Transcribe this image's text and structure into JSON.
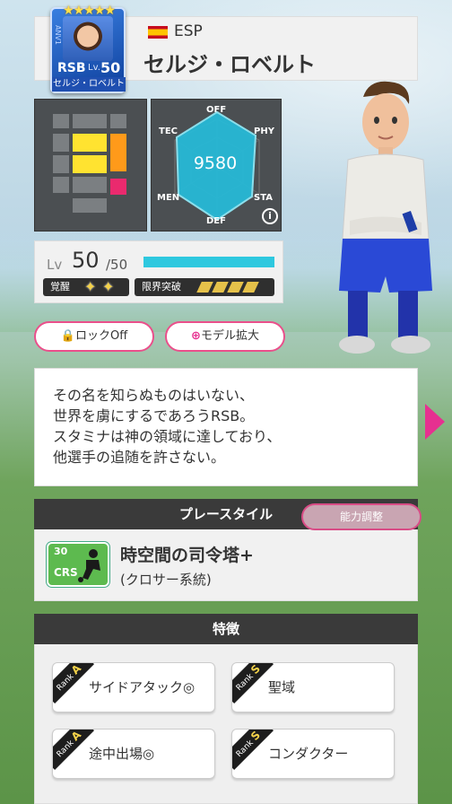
{
  "card": {
    "stars": "★★★★★",
    "position": "RSB",
    "lv_prefix": "Lv.",
    "level": "50",
    "short_name": "セルジ・ロベルト",
    "side_text": "ANV1"
  },
  "header": {
    "country": "ESP",
    "player_name": "セルジ・ロベルト"
  },
  "radar": {
    "value": "9580",
    "labels": {
      "top": "OFF",
      "top_left": "TEC",
      "top_right": "PHY",
      "bottom_left": "MEN",
      "bottom_right": "STA",
      "bottom": "DEF"
    }
  },
  "level": {
    "label": "Lv",
    "current": "50",
    "max": "/50",
    "progress": 1.0,
    "awakening_label": "覚醒",
    "limit_label": "限界突破"
  },
  "buttons": {
    "lock": "ロックOff",
    "model": "モデル拡大"
  },
  "description": [
    "その名を知らぬものはいない、",
    "世界を虜にするであろうRSB。",
    "スタミナは神の領域に達しており、",
    "他選手の追随を許さない。"
  ],
  "play_style": {
    "header": "プレースタイル",
    "ability_button": "能力調整",
    "icon_value": "30",
    "icon_label": "CRS",
    "title": "時空間の司令塔+",
    "subtitle": "(クロサー系統)"
  },
  "traits": {
    "header": "特徴",
    "rank_prefix": "Rank",
    "items": [
      {
        "rank": "A",
        "label": "サイドアタック◎"
      },
      {
        "rank": "S",
        "label": "聖域"
      },
      {
        "rank": "A",
        "label": "途中出場◎"
      },
      {
        "rank": "S",
        "label": "コンダクター"
      }
    ]
  },
  "colors": {
    "accent_pink": "#ea4f8b",
    "cyan": "#2ec8df",
    "yellow": "#ffe330"
  }
}
